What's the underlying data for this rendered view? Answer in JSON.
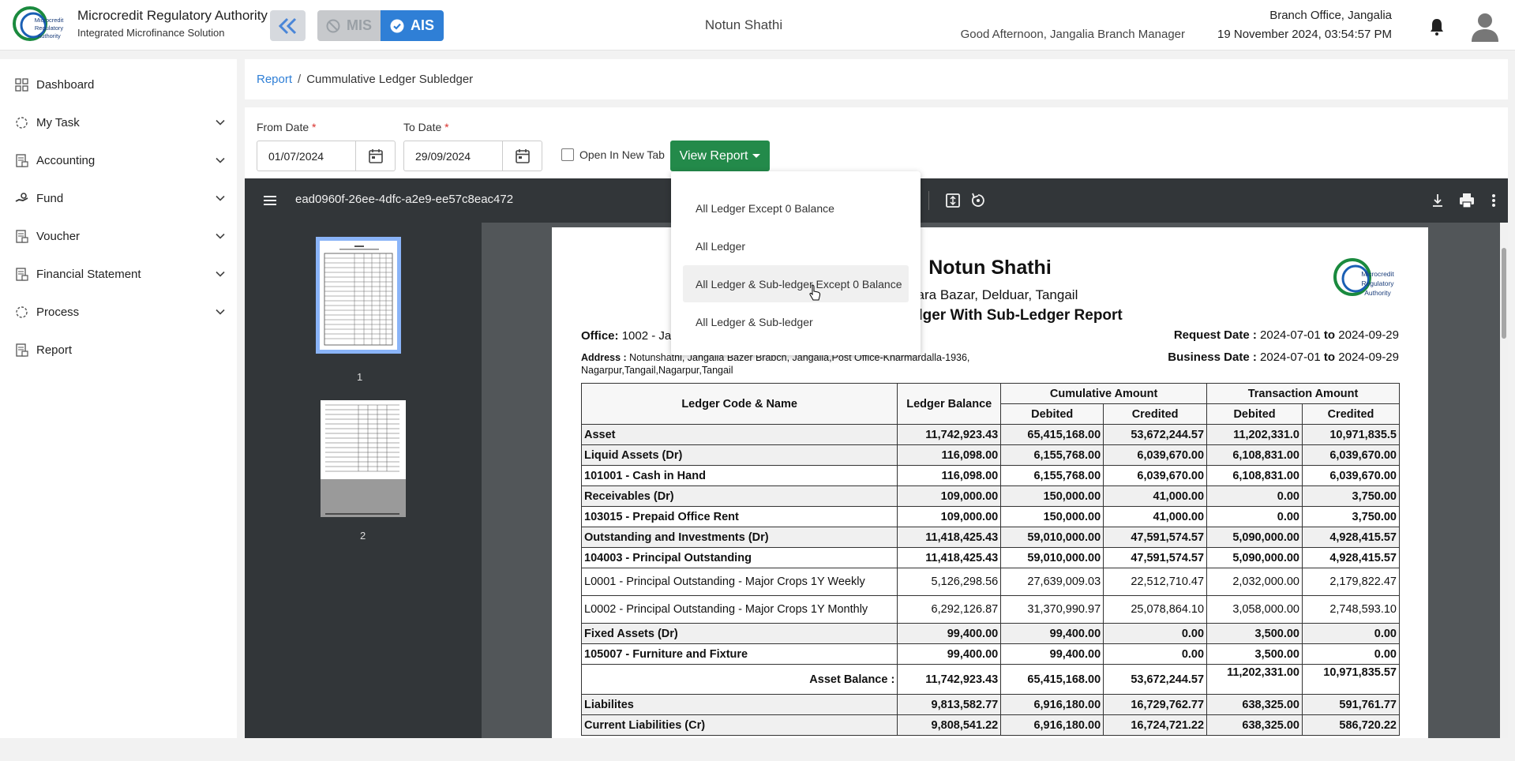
{
  "header": {
    "org_name": "Microcredit Regulatory Authority",
    "org_sub": "Integrated Microfinance Solution",
    "logo_text": [
      "Microcredit",
      "Regulatory",
      "Authority"
    ],
    "mis_label": "MIS",
    "ais_label": "AIS",
    "org_center": "Notun Shathi",
    "greeting": "Good Afternoon, Jangalia Branch Manager",
    "branch": "Branch Office, Jangalia",
    "datetime": "19 November 2024, 03:54:57 PM",
    "accent_color": "#2f7fd6"
  },
  "sidebar": {
    "items": [
      {
        "label": "Dashboard",
        "icon": "dashboard-icon",
        "expandable": false
      },
      {
        "label": "My Task",
        "icon": "task-icon",
        "expandable": true
      },
      {
        "label": "Accounting",
        "icon": "accounting-icon",
        "expandable": true
      },
      {
        "label": "Fund",
        "icon": "fund-icon",
        "expandable": true
      },
      {
        "label": "Voucher",
        "icon": "voucher-icon",
        "expandable": true
      },
      {
        "label": "Financial Statement",
        "icon": "financial-statement-icon",
        "expandable": true
      },
      {
        "label": "Process",
        "icon": "process-icon",
        "expandable": true
      },
      {
        "label": "Report",
        "icon": "report-icon",
        "expandable": false
      }
    ]
  },
  "breadcrumb": {
    "link": "Report",
    "separator": "/",
    "current": "Cummulative Ledger Subledger"
  },
  "filters": {
    "from_label": "From Date",
    "from_value": "01/07/2024",
    "to_label": "To Date",
    "to_value": "29/09/2024",
    "required_mark": "*",
    "open_new_tab_label": "Open In New Tab",
    "open_new_tab_checked": false,
    "view_report_label": "View Report",
    "button_color": "#238a4a"
  },
  "dropdown": {
    "items": [
      "All Ledger Except 0 Balance",
      "All Ledger",
      "All Ledger & Sub-ledger Except 0 Balance",
      "All Ledger & Sub-ledger"
    ],
    "hovered_index": 2
  },
  "pdf": {
    "filename": "ead0960f-26ee-4dfc-a2e9-ee57c8eac472",
    "thumbnails": [
      {
        "label": "1"
      },
      {
        "label": "2"
      }
    ],
    "selected_page": 1
  },
  "report": {
    "org": "Notun Shathi",
    "org_address": "apara Bazar, Delduar, Tangail",
    "subtitle": "ative Ledger With Sub-Ledger Report",
    "office_label": "Office:",
    "office_value": "1002 - Ja",
    "address_label": "Address :",
    "address_value": "Notunshathi, Jangalia Bazer Brabch, Jangalia,Post Office-Kharmardalla-1936, Nagarpur,Tangail,Nagarpur,Tangail",
    "request_date_label": "Request Date :",
    "request_from": "2024-07-01",
    "to_word": "to",
    "request_to": "2024-09-29",
    "business_date_label": "Business Date :",
    "business_from": "2024-07-01",
    "business_to": "2024-09-29",
    "headers": {
      "ledger": "Ledger Code & Name",
      "balance": "Ledger Balance",
      "cumulative": "Cumulative Amount",
      "transaction": "Transaction Amount",
      "debited": "Debited",
      "credited": "Credited"
    },
    "rows": [
      {
        "name": "Asset",
        "balance": "11,742,923.43",
        "cum_dr": "65,415,168.00",
        "cum_cr": "53,672,244.57",
        "tr_dr": "11,202,331.0",
        "tr_cr": "10,971,835.5",
        "level": 0,
        "kind": "grp"
      },
      {
        "name": "Liquid Assets (Dr)",
        "balance": "116,098.00",
        "cum_dr": "6,155,768.00",
        "cum_cr": "6,039,670.00",
        "tr_dr": "6,108,831.00",
        "tr_cr": "6,039,670.00",
        "level": 1,
        "kind": "sub"
      },
      {
        "name": "101001 - Cash in Hand",
        "balance": "116,098.00",
        "cum_dr": "6,155,768.00",
        "cum_cr": "6,039,670.00",
        "tr_dr": "6,108,831.00",
        "tr_cr": "6,039,670.00",
        "level": 2,
        "kind": "led"
      },
      {
        "name": "Receivables (Dr)",
        "balance": "109,000.00",
        "cum_dr": "150,000.00",
        "cum_cr": "41,000.00",
        "tr_dr": "0.00",
        "tr_cr": "3,750.00",
        "level": 1,
        "kind": "sub"
      },
      {
        "name": "103015 - Prepaid Office Rent",
        "balance": "109,000.00",
        "cum_dr": "150,000.00",
        "cum_cr": "41,000.00",
        "tr_dr": "0.00",
        "tr_cr": "3,750.00",
        "level": 2,
        "kind": "led"
      },
      {
        "name": "Outstanding and Investments (Dr)",
        "balance": "11,418,425.43",
        "cum_dr": "59,010,000.00",
        "cum_cr": "47,591,574.57",
        "tr_dr": "5,090,000.00",
        "tr_cr": "4,928,415.57",
        "level": 1,
        "kind": "sub"
      },
      {
        "name": "104003 - Principal Outstanding",
        "balance": "11,418,425.43",
        "cum_dr": "59,010,000.00",
        "cum_cr": "47,591,574.57",
        "tr_dr": "5,090,000.00",
        "tr_cr": "4,928,415.57",
        "level": 2,
        "kind": "led"
      },
      {
        "name": "L0001 - Principal Outstanding - Major Crops 1Y Weekly",
        "balance": "5,126,298.56",
        "cum_dr": "27,639,009.03",
        "cum_cr": "22,512,710.47",
        "tr_dr": "2,032,000.00",
        "tr_cr": "2,179,822.47",
        "level": 3,
        "kind": "sl"
      },
      {
        "name": "L0002 - Principal Outstanding - Major Crops 1Y Monthly",
        "balance": "6,292,126.87",
        "cum_dr": "31,370,990.97",
        "cum_cr": "25,078,864.10",
        "tr_dr": "3,058,000.00",
        "tr_cr": "2,748,593.10",
        "level": 3,
        "kind": "sl"
      },
      {
        "name": "Fixed Assets (Dr)",
        "balance": "99,400.00",
        "cum_dr": "99,400.00",
        "cum_cr": "0.00",
        "tr_dr": "3,500.00",
        "tr_cr": "0.00",
        "level": 1,
        "kind": "sub"
      },
      {
        "name": "105007 - Furniture and Fixture",
        "balance": "99,400.00",
        "cum_dr": "99,400.00",
        "cum_cr": "0.00",
        "tr_dr": "3,500.00",
        "tr_cr": "0.00",
        "level": 2,
        "kind": "led"
      },
      {
        "name": "Asset Balance :",
        "balance": "11,742,923.43",
        "cum_dr": "65,415,168.00",
        "cum_cr": "53,672,244.57",
        "tr_dr": "11,202,331.00",
        "tr_cr": "10,971,835.57",
        "level": 0,
        "kind": "bal"
      },
      {
        "name": "Liabilites",
        "balance": "9,813,582.77",
        "cum_dr": "6,916,180.00",
        "cum_cr": "16,729,762.77",
        "tr_dr": "638,325.00",
        "tr_cr": "591,761.77",
        "level": 0,
        "kind": "grp"
      },
      {
        "name": "Current Liabilities (Cr)",
        "balance": "9,808,541.22",
        "cum_dr": "6,916,180.00",
        "cum_cr": "16,724,721.22",
        "tr_dr": "638,325.00",
        "tr_cr": "586,720.22",
        "level": 1,
        "kind": "sub"
      }
    ]
  }
}
